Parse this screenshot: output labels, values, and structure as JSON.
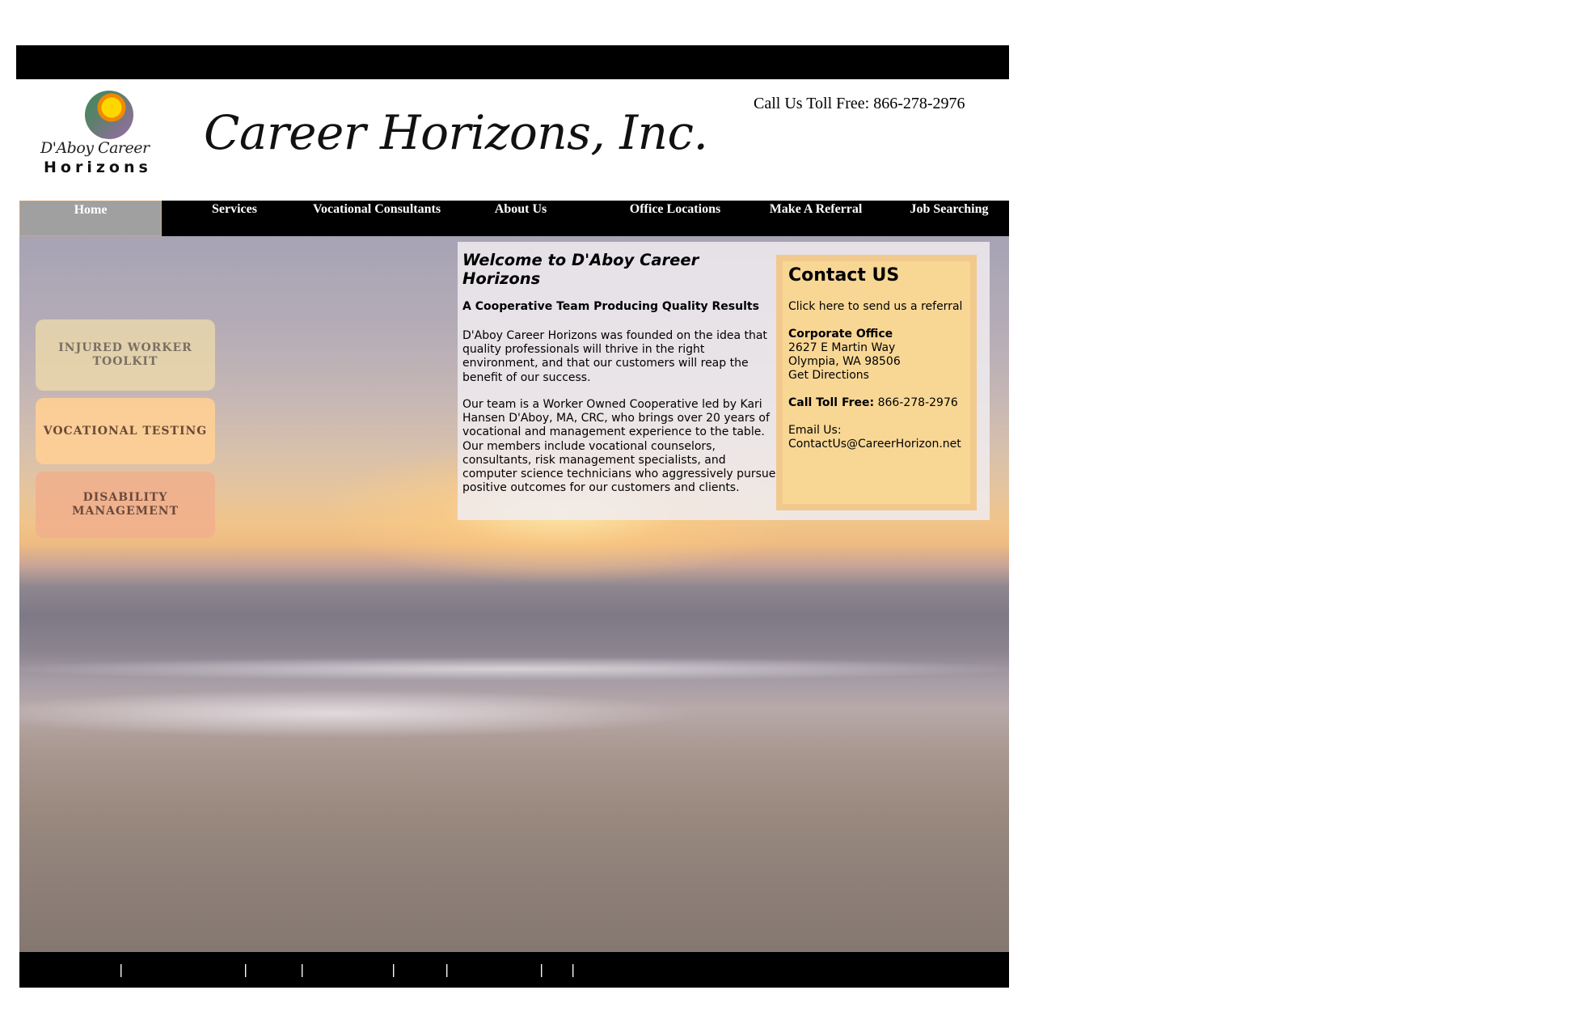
{
  "header": {
    "logo_line1": "D'Aboy Career",
    "logo_line2": "Horizons",
    "site_title": "Career Horizons, Inc.",
    "toll_free": "Call Us Toll Free: 866-278-2976"
  },
  "nav": {
    "items": [
      {
        "label": "Home",
        "active": true
      },
      {
        "label": "Services"
      },
      {
        "label": "Vocational Consultants"
      },
      {
        "label": "About Us"
      },
      {
        "label": "Office Locations"
      },
      {
        "label": "Make A Referral"
      },
      {
        "label": "Job Searching"
      }
    ]
  },
  "sidebar": {
    "injured": "INJURED WORKER TOOLKIT",
    "vocational": "VOCATIONAL TESTING",
    "disability": "DISABILITY MANAGEMENT"
  },
  "welcome": {
    "title": "Welcome to D'Aboy Career Horizons",
    "subtitle": "A Cooperative Team Producing Quality Results",
    "para1": "D'Aboy Career Horizons was founded on the idea that quality professionals will thrive in the right environment, and that our customers will reap the benefit of our success.",
    "para2": "Our team is a Worker Owned Cooperative led by Kari Hansen D'Aboy, MA, CRC, who brings over 20 years of vocational and management experience to the table. Our members include vocational counselors, consultants, risk management specialists, and computer science technicians who aggressively pursue positive outcomes for our customers and clients."
  },
  "contact": {
    "title": "Contact US",
    "referral_link": "Click here to send us a referral",
    "office_heading": "Corporate Office",
    "address1": "2627 E Martin Way",
    "address2": "Olympia, WA 98506",
    "directions": "Get Directions",
    "call_label": "Call Toll Free:",
    "call_number": "866-278-2976",
    "email_label": "Email Us:",
    "email": "ContactUs@CareerHorizon.net"
  },
  "footer": {
    "separators": [
      "|",
      "|",
      "|",
      "|",
      "|",
      "|",
      "|"
    ]
  },
  "colors": {
    "bar": "#000000",
    "active_nav": "#a0a0a0",
    "contact_bg": "#f8d795"
  }
}
